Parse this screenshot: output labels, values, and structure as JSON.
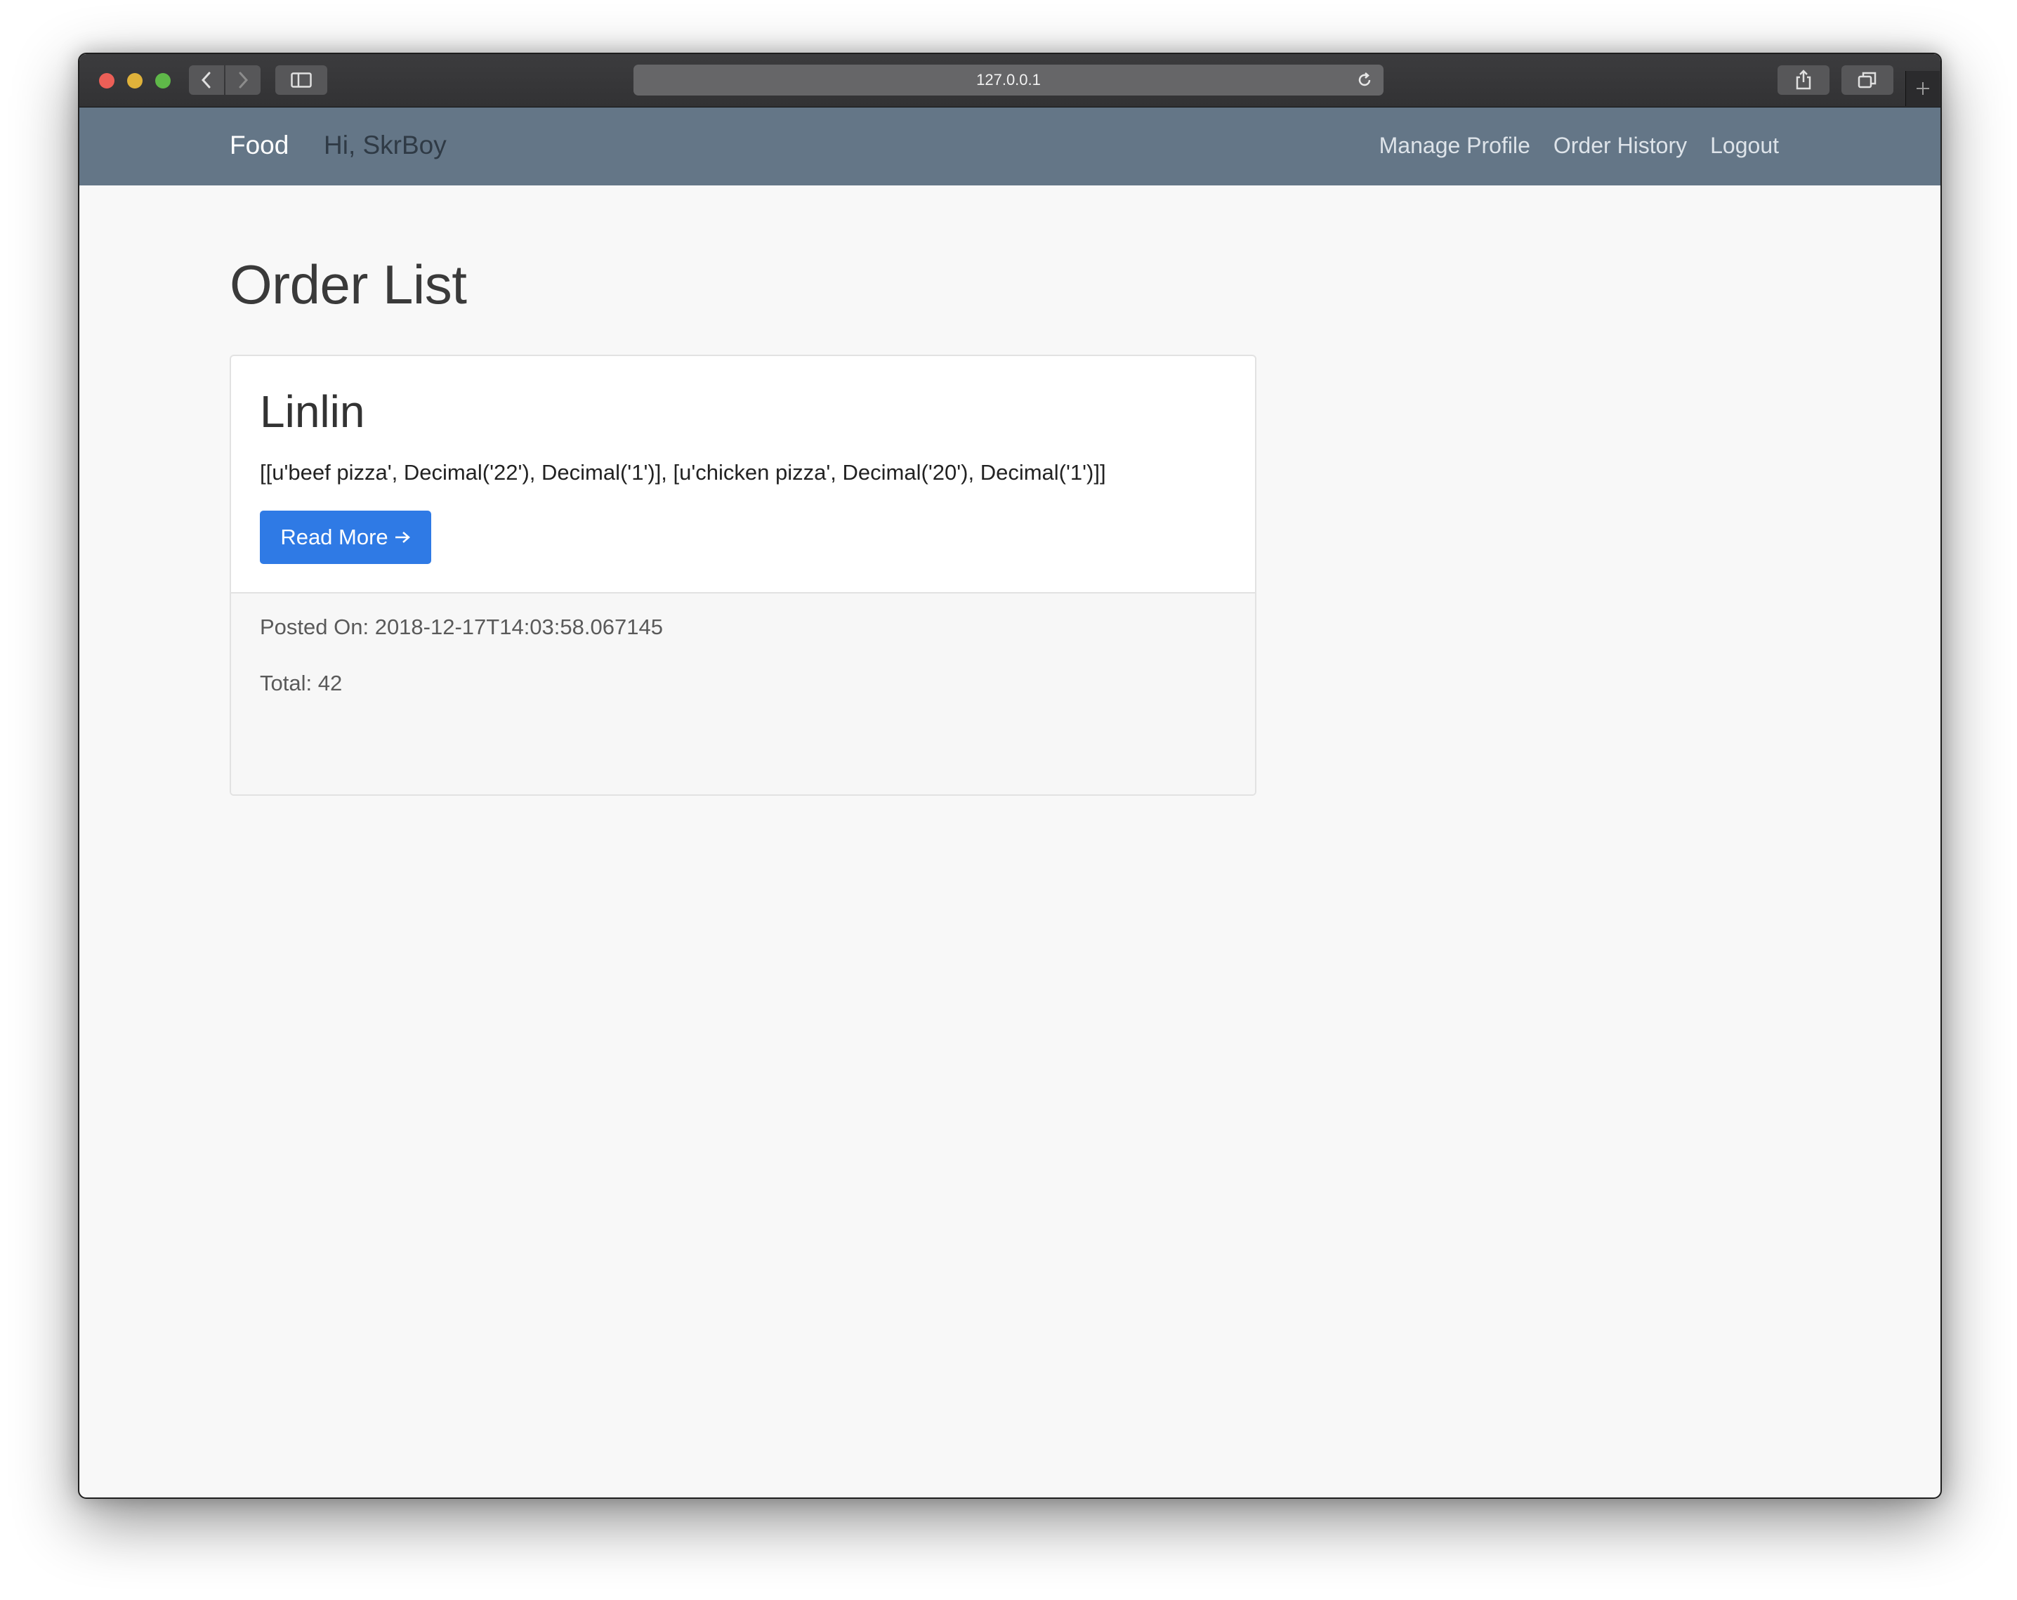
{
  "browser": {
    "url": "127.0.0.1"
  },
  "navbar": {
    "brand": "Food",
    "greeting": "Hi, SkrBoy",
    "links": [
      "Manage Profile",
      "Order History",
      "Logout"
    ]
  },
  "main": {
    "title": "Order List",
    "orders": [
      {
        "name": "Linlin",
        "items_text": "[[u'beef pizza', Decimal('22'), Decimal('1')], [u'chicken pizza', Decimal('20'), Decimal('1')]]",
        "button_label": "Read More",
        "posted_on": "Posted On: 2018-12-17T14:03:58.067145",
        "total": "Total: 42"
      }
    ]
  }
}
